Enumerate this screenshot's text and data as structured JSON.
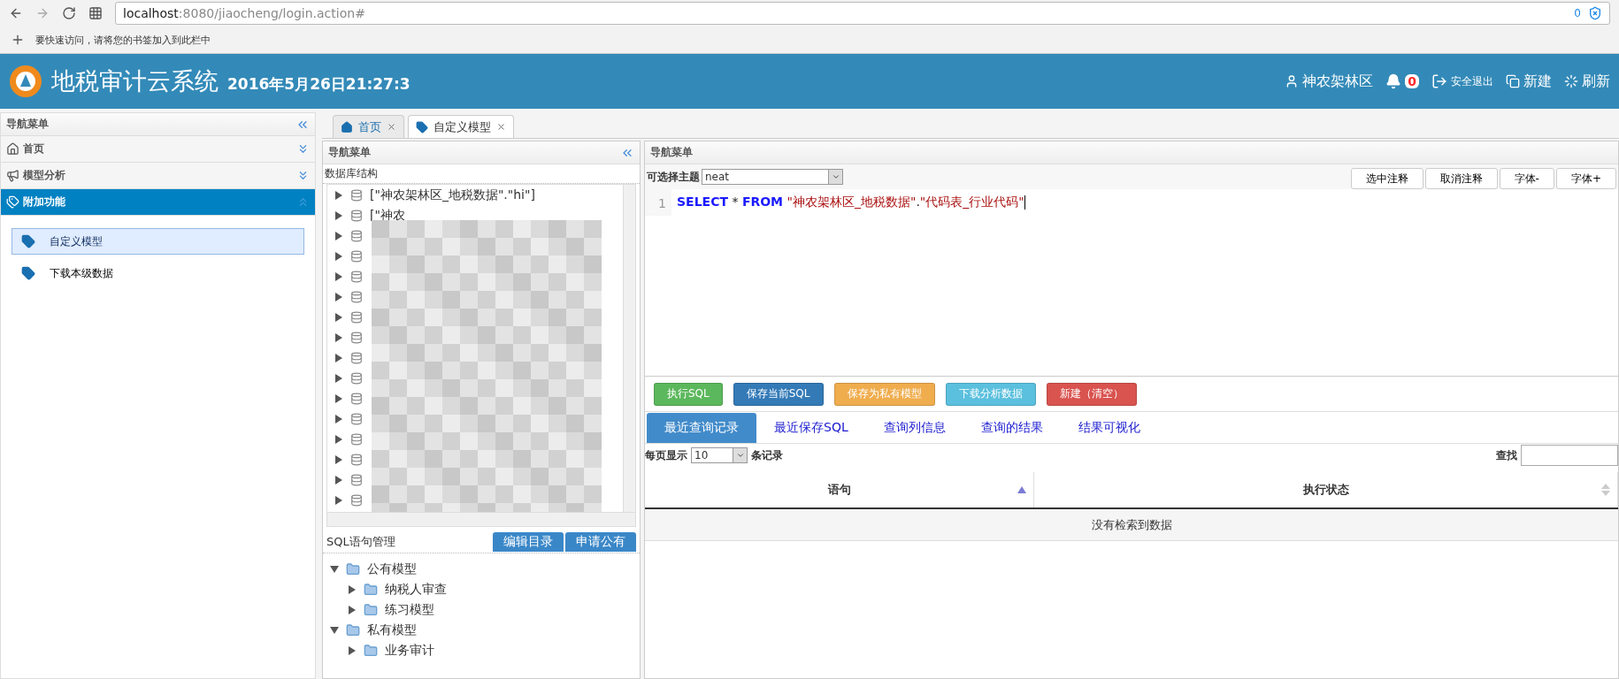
{
  "browser": {
    "address_host": "localhost",
    "address_path": ":8080/jiaocheng/login.action#",
    "shield_count": "0",
    "bookmarks_hint": "要快速访问，请将您的书签加入到此栏中"
  },
  "header": {
    "title": "地税审计云系统",
    "datetime": "2016年5月26日21:27:3",
    "user": "神农架林区",
    "notifications": "0",
    "logout": "安全退出",
    "new": "新建",
    "refresh": "刷新"
  },
  "sidebar": {
    "title": "导航菜单",
    "sections": [
      {
        "kind": "home",
        "label": "首页",
        "expanded": false
      },
      {
        "kind": "megaphone",
        "label": "模型分析",
        "expanded": false
      },
      {
        "kind": "tags",
        "label": "附加功能",
        "expanded": true
      }
    ],
    "items": [
      {
        "label": "自定义模型",
        "selected": true
      },
      {
        "label": "下载本级数据",
        "selected": false
      }
    ]
  },
  "tabs": [
    {
      "kind": "home",
      "label": "首页",
      "selected": false
    },
    {
      "kind": "tag",
      "label": "自定义模型",
      "selected": true
    }
  ],
  "middle": {
    "title": "导航菜单",
    "db_label": "数据库结构",
    "db_rows": [
      {
        "kind": "text",
        "text": "[\"神农架林区_地税数据\".\"hi\"]"
      },
      {
        "kind": "text",
        "text": "[\"神农"
      },
      {
        "kind": "hidden"
      },
      {
        "kind": "hidden"
      },
      {
        "kind": "hidden"
      },
      {
        "kind": "hidden"
      },
      {
        "kind": "hidden"
      },
      {
        "kind": "hidden"
      },
      {
        "kind": "hidden"
      },
      {
        "kind": "hidden"
      },
      {
        "kind": "hidden"
      },
      {
        "kind": "hidden"
      },
      {
        "kind": "hidden"
      },
      {
        "kind": "hidden"
      },
      {
        "kind": "hidden"
      },
      {
        "kind": "hidden"
      }
    ],
    "sql_label": "SQL语句管理",
    "sql_buttons": [
      "编辑目录",
      "申请公有"
    ],
    "model_tree": [
      {
        "label": "公有模型",
        "expanded": true,
        "children": [
          {
            "label": "纳税人审查",
            "expanded": false
          },
          {
            "label": "练习模型",
            "expanded": false
          }
        ]
      },
      {
        "label": "私有模型",
        "expanded": true,
        "children": [
          {
            "label": "业务审计",
            "expanded": false
          }
        ]
      }
    ]
  },
  "right": {
    "title": "导航菜单",
    "theme_label": "可选择主题",
    "theme_value": "neat",
    "toolbar_buttons": [
      "选中注释",
      "取消注释",
      "字体-",
      "字体+"
    ],
    "editor": {
      "line_number": "1",
      "tokens": [
        {
          "kind": "keyword",
          "text": "SELECT"
        },
        {
          "kind": "plain",
          "text": " * "
        },
        {
          "kind": "keyword",
          "text": "FROM"
        },
        {
          "kind": "string",
          "text": " \"神农架林区_地税数据\""
        },
        {
          "kind": "plain",
          "text": "."
        },
        {
          "kind": "string",
          "text": "\"代码表_行业代码\""
        }
      ]
    },
    "action_buttons": [
      {
        "label": "执行SQL",
        "color": "#5cb85c"
      },
      {
        "label": "保存当前SQL",
        "color": "#337ab7"
      },
      {
        "label": "保存为私有模型",
        "color": "#f0ad4e"
      },
      {
        "label": "下载分析数据",
        "color": "#5bc0de"
      },
      {
        "label": "新建（清空）",
        "color": "#d9534f"
      }
    ],
    "result_tabs": [
      {
        "label": "最近查询记录",
        "selected": true
      },
      {
        "label": "最近保存SQL",
        "selected": false
      },
      {
        "label": "查询列信息",
        "selected": false
      },
      {
        "label": "查询的结果",
        "selected": false
      },
      {
        "label": "结果可视化",
        "selected": false
      }
    ],
    "page_size_label": "每页显示",
    "page_size": "10",
    "records_label": "条记录",
    "search_label": "查找",
    "table": {
      "columns": [
        {
          "label": "语句",
          "sorted": true
        },
        {
          "label": "执行状态",
          "sorted": false
        }
      ],
      "empty_message": "没有检索到数据"
    }
  }
}
